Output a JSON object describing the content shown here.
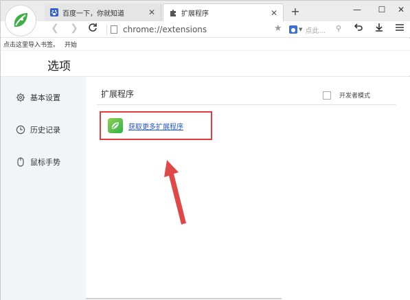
{
  "tabs": [
    {
      "label": "百度一下，你就知道",
      "icon": "paw-icon"
    },
    {
      "label": "扩展程序",
      "icon": "puzzle-icon"
    }
  ],
  "toolbar": {
    "url": "chrome://extensions",
    "search_placeholder": "点此..."
  },
  "bookmarks": {
    "import_text": "点击这里导入书签。",
    "start_text": "开始"
  },
  "header": {
    "title": "选项"
  },
  "sidebar": {
    "items": [
      {
        "label": "基本设置",
        "icon": "gear-icon"
      },
      {
        "label": "历史记录",
        "icon": "clock-icon"
      },
      {
        "label": "鼠标手势",
        "icon": "mouse-icon"
      }
    ]
  },
  "main": {
    "section_title": "扩展程序",
    "dev_mode_label": "开发者模式",
    "get_more_label": "获取更多扩展程序"
  },
  "colors": {
    "highlight": "#e33b3b",
    "link": "#2554c7",
    "sidebar_bg": "#f1f5f8"
  }
}
